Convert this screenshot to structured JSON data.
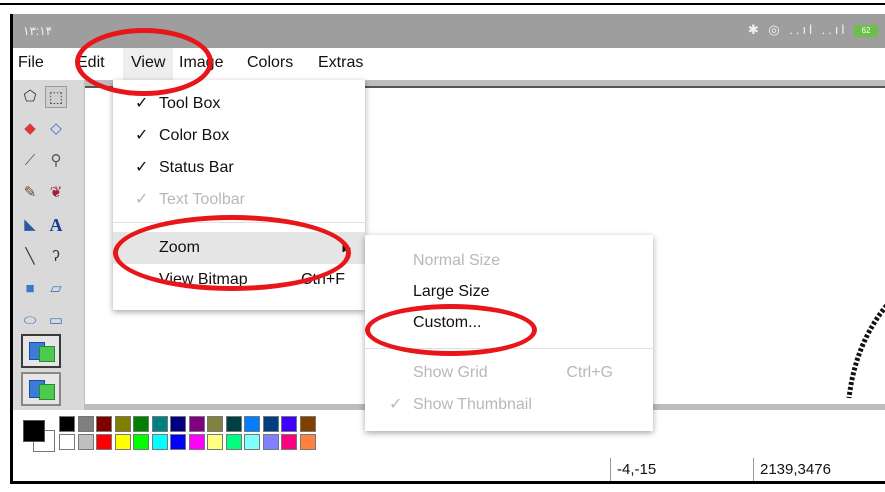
{
  "statusbar": {
    "time": "۱۳:۱۴",
    "icons": "✱ ◎ ..ıl ..ıl",
    "battery": "62"
  },
  "menubar": {
    "items": [
      "File",
      "Edit",
      "View",
      "Image",
      "Colors",
      "Extras"
    ]
  },
  "toolbox": {
    "tools": [
      "free-select-icon",
      "rect-select-icon",
      "eraser-icon",
      "fill-bucket-icon",
      "color-picker-icon",
      "magnifier-icon",
      "pencil-icon",
      "brush-icon",
      "airbrush-icon",
      "text-icon",
      "line-icon",
      "curve-icon",
      "rectangle-icon",
      "polygon-icon",
      "ellipse-icon",
      "rounded-rect-icon"
    ],
    "text_tool_glyph": "A"
  },
  "view_menu": {
    "items": [
      {
        "check": "✓",
        "label": "Tool Box",
        "enabled": true
      },
      {
        "check": "✓",
        "label": "Color Box",
        "enabled": true
      },
      {
        "check": "✓",
        "label": "Status Bar",
        "enabled": true
      },
      {
        "check": "✓",
        "label": "Text Toolbar",
        "enabled": false
      },
      {
        "check": "",
        "label": "Zoom",
        "submenu_arrow": "▶",
        "enabled": true
      },
      {
        "check": "",
        "label": "View Bitmap",
        "shortcut": "Ctrl+F",
        "enabled": true
      }
    ]
  },
  "zoom_menu": {
    "items": [
      {
        "check": "",
        "label": "Normal Size",
        "enabled": false
      },
      {
        "check": "",
        "label": "Large Size",
        "enabled": true
      },
      {
        "check": "",
        "label": "Custom...",
        "enabled": true
      },
      {
        "check": "",
        "label": "Show Grid",
        "shortcut": "Ctrl+G",
        "enabled": false
      },
      {
        "check": "✓",
        "label": "Show Thumbnail",
        "enabled": false
      }
    ]
  },
  "palette": {
    "primary": "#000000",
    "secondary": "#ffffff",
    "row1": [
      "#000000",
      "#808080",
      "#800000",
      "#808000",
      "#008000",
      "#008080",
      "#000080",
      "#800080",
      "#808040",
      "#004040",
      "#0080ff",
      "#004080",
      "#4000ff",
      "#804000"
    ],
    "row2": [
      "#ffffff",
      "#c0c0c0",
      "#ff0000",
      "#ffff00",
      "#00ff00",
      "#00ffff",
      "#0000ff",
      "#ff00ff",
      "#ffff80",
      "#00ff80",
      "#80ffff",
      "#8080ff",
      "#ff0080",
      "#ff8040"
    ]
  },
  "bottombar": {
    "cursor_pos": "-4,-15",
    "image_size": "2139,3476"
  },
  "annotation_color": "#e8161b"
}
